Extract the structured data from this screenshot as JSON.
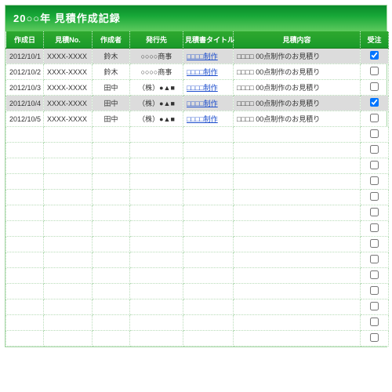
{
  "title": "20○○年 見積作成記録",
  "columns": {
    "date": "作成日",
    "no": "見積No.",
    "author": "作成者",
    "dest": "発行先",
    "title": "見積書タイトル",
    "content": "見積内容",
    "order": "受注"
  },
  "rows": [
    {
      "date": "2012/10/1",
      "no": "XXXX-XXXX",
      "author": "鈴木",
      "dest": "○○○○商事",
      "title": "□□□□制作",
      "content": "□□□□ 00点制作のお見積り",
      "order": true,
      "highlight": true
    },
    {
      "date": "2012/10/2",
      "no": "XXXX-XXXX",
      "author": "鈴木",
      "dest": "○○○○商事",
      "title": "□□□□制作",
      "content": "□□□□ 00点制作のお見積り",
      "order": false,
      "highlight": false
    },
    {
      "date": "2012/10/3",
      "no": "XXXX-XXXX",
      "author": "田中",
      "dest": "（株）●▲■",
      "title": "□□□□制作",
      "content": "□□□□ 00点制作のお見積り",
      "order": false,
      "highlight": false
    },
    {
      "date": "2012/10/4",
      "no": "XXXX-XXXX",
      "author": "田中",
      "dest": "（株）●▲■",
      "title": "□□□□制作",
      "content": "□□□□ 00点制作のお見積り",
      "order": true,
      "highlight": true
    },
    {
      "date": "2012/10/5",
      "no": "XXXX-XXXX",
      "author": "田中",
      "dest": "（株）●▲■",
      "title": "□□□□制作",
      "content": "□□□□ 00点制作のお見積り",
      "order": false,
      "highlight": false
    }
  ],
  "empty_row_count": 14
}
